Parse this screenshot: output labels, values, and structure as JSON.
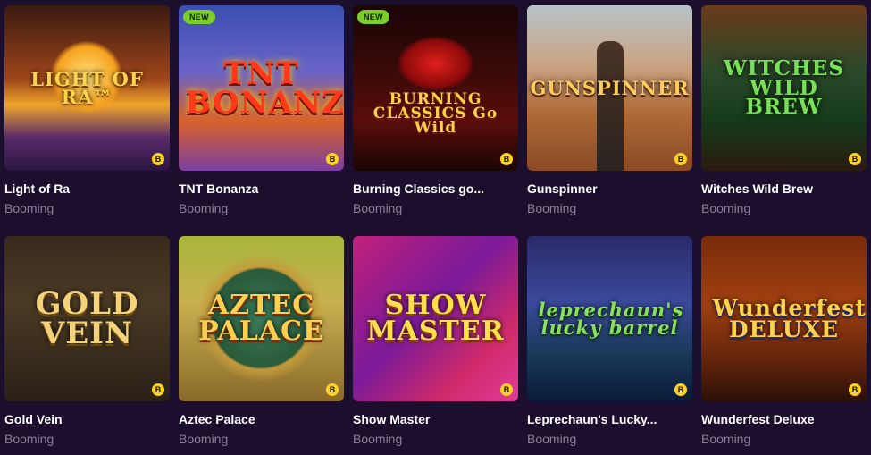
{
  "badges": {
    "new": "NEW",
    "provider_icon": "B"
  },
  "games": [
    {
      "title": "Light of Ra",
      "provider": "Booming",
      "logo": "LIGHT OF RA™",
      "new": false
    },
    {
      "title": "TNT Bonanza",
      "provider": "Booming",
      "logo": "TNT BONANZA",
      "new": true
    },
    {
      "title": "Burning Classics go...",
      "provider": "Booming",
      "logo": "BURNING CLASSICS Go Wild",
      "new": true
    },
    {
      "title": "Gunspinner",
      "provider": "Booming",
      "logo": "GUNSPINNER",
      "new": false
    },
    {
      "title": "Witches Wild Brew",
      "provider": "Booming",
      "logo": "WITCHES WILD BREW",
      "new": false
    },
    {
      "title": "Gold Vein",
      "provider": "Booming",
      "logo": "GOLD VEIN",
      "new": false
    },
    {
      "title": "Aztec Palace",
      "provider": "Booming",
      "logo": "AZTEC PALACE",
      "new": false
    },
    {
      "title": "Show Master",
      "provider": "Booming",
      "logo": "SHOW MASTER",
      "new": false
    },
    {
      "title": "Leprechaun's Lucky...",
      "provider": "Booming",
      "logo": "leprechaun's lucky barrel",
      "new": false
    },
    {
      "title": "Wunderfest Deluxe",
      "provider": "Booming",
      "logo": "Wunderfest DELUXE",
      "new": false
    }
  ],
  "colors": {
    "background": "#1c0f2e",
    "provider_text": "#8a7f98",
    "new_badge": "#7ccf2a",
    "provider_badge": "#ffd21f"
  }
}
